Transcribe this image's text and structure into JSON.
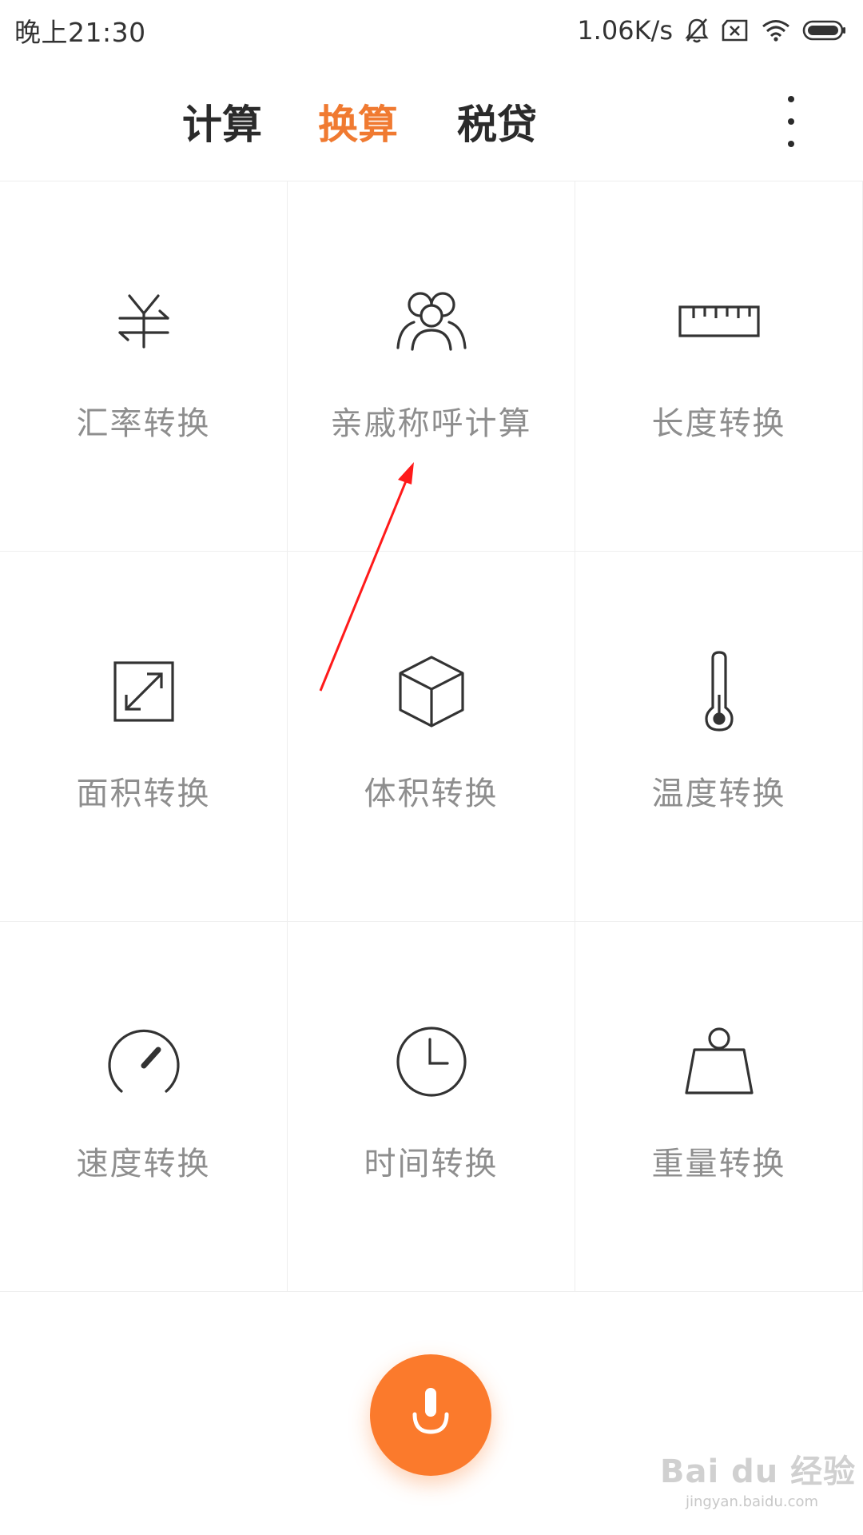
{
  "status_bar": {
    "time": "晚上21:30",
    "net_speed": "1.06K/s",
    "icons": [
      "bell-off-icon",
      "sim-error-icon",
      "wifi-icon",
      "battery-icon"
    ]
  },
  "header": {
    "tabs": [
      {
        "label": "计算",
        "active": false
      },
      {
        "label": "换算",
        "active": true
      },
      {
        "label": "税贷",
        "active": false
      }
    ],
    "more_icon": "more-vertical-icon"
  },
  "grid": {
    "items": [
      {
        "label": "汇率转换",
        "icon": "currency-exchange-icon"
      },
      {
        "label": "亲戚称呼计算",
        "icon": "relatives-icon"
      },
      {
        "label": "长度转换",
        "icon": "ruler-icon"
      },
      {
        "label": "面积转换",
        "icon": "area-resize-icon"
      },
      {
        "label": "体积转换",
        "icon": "cube-icon"
      },
      {
        "label": "温度转换",
        "icon": "thermometer-icon"
      },
      {
        "label": "速度转换",
        "icon": "speedometer-icon"
      },
      {
        "label": "时间转换",
        "icon": "clock-icon"
      },
      {
        "label": "重量转换",
        "icon": "weight-icon"
      }
    ]
  },
  "voice_button": {
    "icon": "microphone-icon"
  },
  "watermark": {
    "logo": "Bai du 经验",
    "url": "jingyan.baidu.com"
  },
  "colors": {
    "accent": "#f07a31",
    "mic": "#fb7a2c",
    "label": "#8e8e8e",
    "annotation": "#ff1a1a"
  }
}
